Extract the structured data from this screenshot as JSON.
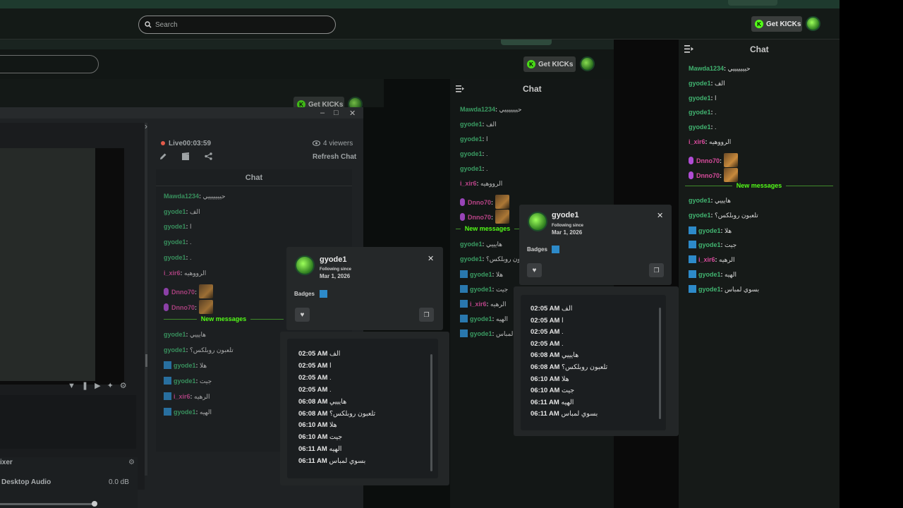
{
  "browser": {
    "search_placeholder": "Search",
    "get_kicks_label": "Get KICKs",
    "kick_logo_letter": "K"
  },
  "obs": {
    "live_text": "Live00:03:59",
    "viewers_text": "4 viewers",
    "refresh_label": "Refresh Chat",
    "chat_title": "Chat",
    "mixer_title": "ixer",
    "desktop_audio_label": "Desktop Audio",
    "desktop_audio_level": "0.0 dB"
  },
  "chat": {
    "title": "Chat",
    "new_messages_label": "New messages",
    "messages": [
      {
        "user": "Mawda1234",
        "text": "حيييييييي"
      },
      {
        "user": "gyode1",
        "text": "الف"
      },
      {
        "user": "gyode1",
        "text": "ا"
      },
      {
        "user": "gyode1",
        "text": "."
      },
      {
        "user": "gyode1",
        "text": "."
      },
      {
        "user": "i_xir6",
        "text": "الرووهيه"
      },
      {
        "user": "Dnno70",
        "text": ""
      },
      {
        "user": "Dnno70",
        "text": ""
      }
    ],
    "new_messages": [
      {
        "user": "gyode1",
        "text": "هايييي"
      },
      {
        "user": "gyode1",
        "text": "تلعبون روبلكس؟"
      },
      {
        "user": "gyode1",
        "text": "هلا"
      },
      {
        "user": "gyode1",
        "text": "جيت"
      },
      {
        "user": "i_xir6",
        "text": "الرهيه"
      },
      {
        "user": "gyode1",
        "text": "الهيه"
      },
      {
        "user": "gyode1",
        "text": "بسوي لمباس"
      }
    ]
  },
  "usercard": {
    "username": "gyode1",
    "following_label": "Following since",
    "following_date": "Mar 1, 2026",
    "badges_label": "Badges",
    "history": [
      {
        "time": "02:05 AM",
        "text": "الف"
      },
      {
        "time": "02:05 AM",
        "text": "ا"
      },
      {
        "time": "02:05 AM",
        "text": "."
      },
      {
        "time": "02:05 AM",
        "text": "."
      },
      {
        "time": "06:08 AM",
        "text": "هايييي"
      },
      {
        "time": "06:08 AM",
        "text": "تلعبون روبلكس؟"
      },
      {
        "time": "06:10 AM",
        "text": "هلا"
      },
      {
        "time": "06:10 AM",
        "text": "جيت"
      },
      {
        "time": "06:11 AM",
        "text": "الهيه"
      },
      {
        "time": "06:11 AM",
        "text": "بسوي لمباس"
      }
    ]
  },
  "colors": {
    "username_green": "#41b370",
    "username_pink": "#d64b9b",
    "kick_green": "#53fc18"
  },
  "icons": [
    "search-icon",
    "chat-collapse-icon",
    "close-icon",
    "heart-icon",
    "copy-icon",
    "eye-icon",
    "pencil-icon",
    "clapper-icon",
    "share-icon",
    "mic-icon",
    "gear-icon"
  ]
}
